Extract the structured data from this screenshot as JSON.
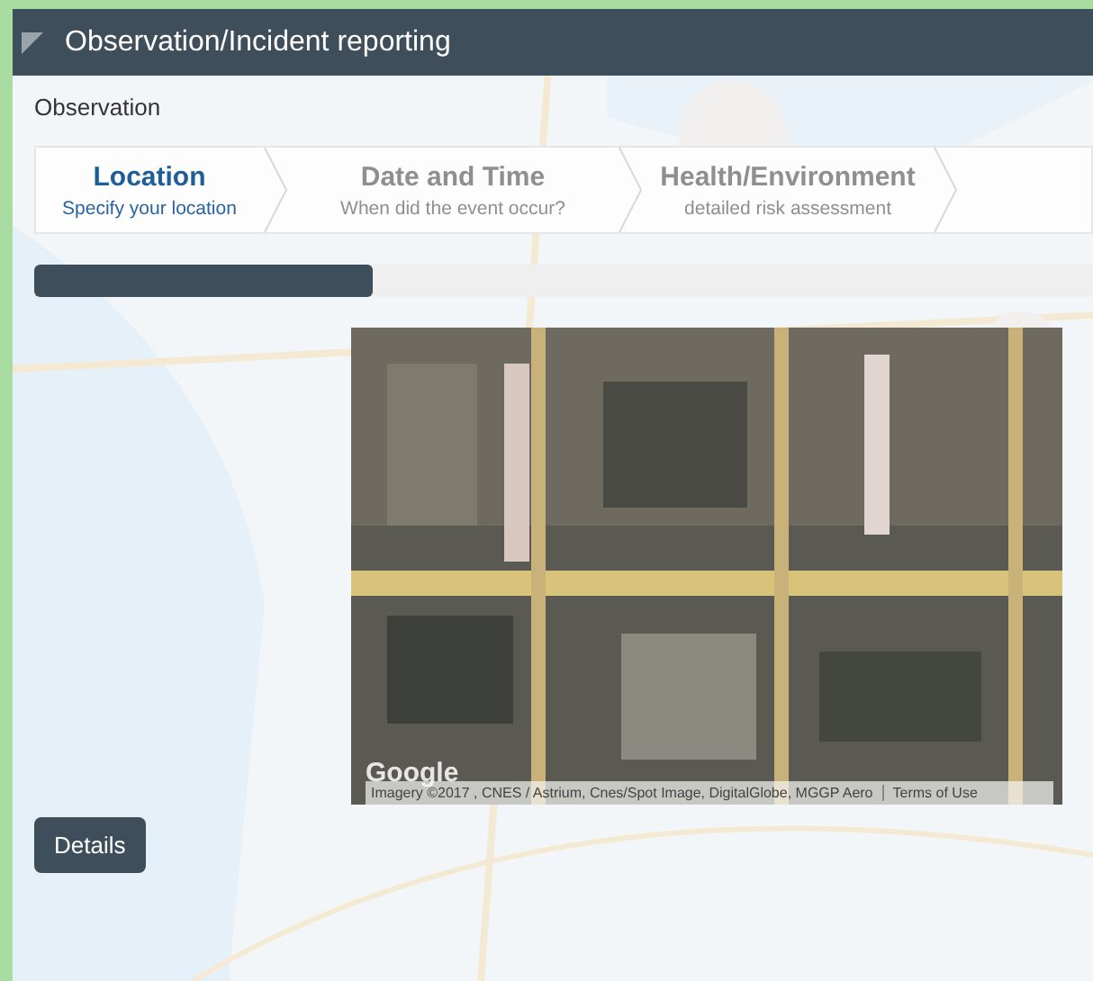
{
  "window": {
    "title": "Observation/Incident reporting"
  },
  "form": {
    "heading": "Observation"
  },
  "steps": [
    {
      "title": "Location",
      "subtitle": "Specify your location",
      "selected": true
    },
    {
      "title": "Date and Time",
      "subtitle": "When did the event occur?",
      "selected": false
    },
    {
      "title": "Health/Environment",
      "subtitle": "detailed risk assessment",
      "selected": false
    }
  ],
  "progress": {
    "level": 0.32
  },
  "map": {
    "logo": "Google",
    "attribution": "Imagery ©2017 , CNES / Astrium, Cnes/Spot Image, DigitalGlobe, MGGP Aero",
    "terms_link": "Terms of Use"
  },
  "buttons": [
    "Details"
  ]
}
